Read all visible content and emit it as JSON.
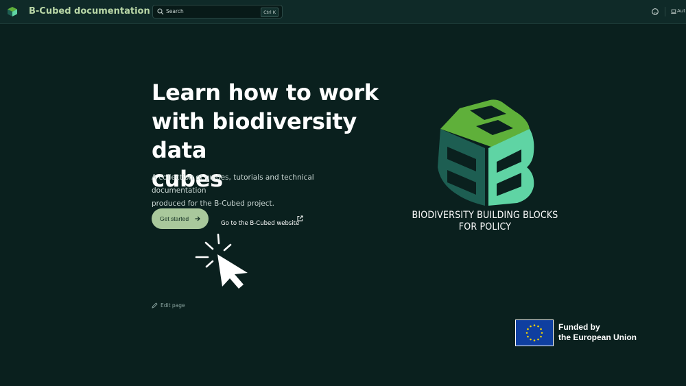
{
  "navbar": {
    "title": "B-Cubed documentation",
    "search": {
      "placeholder": "Search",
      "shortcut": "Ctrl K"
    },
    "theme_label": "Aut"
  },
  "hero": {
    "title_lines": [
      "Learn how to work",
      "with biodiversity data",
      "cubes"
    ],
    "tagline_lines": [
      "A collection of guides, tutorials and technical documentation",
      "produced for the B-Cubed project."
    ],
    "primary_button": "Get started",
    "secondary_link": "Go to the B-Cubed website"
  },
  "edit_page": "Edit page",
  "project_logo": {
    "caption_lines": [
      "BIODIVERSITY BUILDING BLOCKS",
      "FOR POLICY"
    ],
    "colors": {
      "light_green": "#5fb03a",
      "mint": "#5fd4a4",
      "dark_teal": "#1d5e52"
    }
  },
  "funding": {
    "lines": [
      "Funded by",
      "the European Union"
    ],
    "flag_color": "#0f3fa0",
    "star_color": "#f5d400"
  },
  "colors": {
    "background": "#0a201e",
    "navbar": "#0f2a28",
    "accent": "#a9c89c"
  }
}
